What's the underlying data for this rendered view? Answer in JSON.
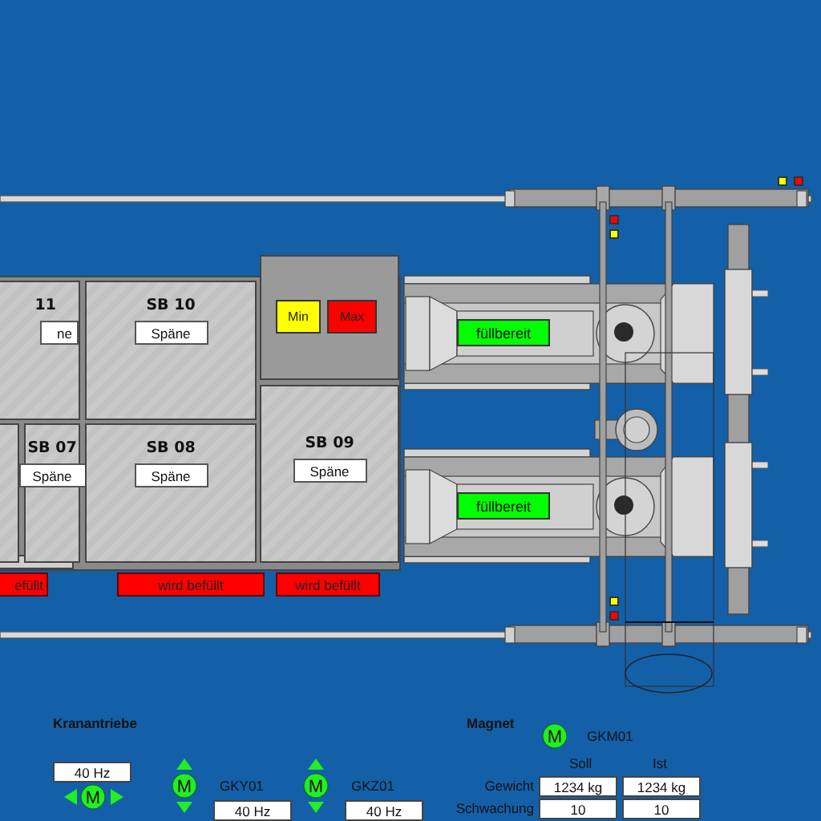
{
  "bunkers": [
    {
      "name": "11",
      "material": "ne"
    },
    {
      "name": "SB 10",
      "material": "Späne"
    },
    {
      "name": "SB 07",
      "material": "Späne"
    },
    {
      "name": "SB 08",
      "material": "Späne"
    },
    {
      "name": "SB 09",
      "material": "Späne"
    }
  ],
  "level_alarms": [
    {
      "label": "Min",
      "color": "#ffff00"
    },
    {
      "label": "Max",
      "color": "#ff0000"
    }
  ],
  "fill_status": [
    "efüllt",
    "wird befüllt",
    "wird befüllt"
  ],
  "presses": [
    {
      "status": "füllbereit"
    },
    {
      "status": "füllbereit"
    }
  ],
  "indicators": [
    {
      "color": "#ffff00"
    },
    {
      "color": "#ff0000"
    },
    {
      "color": "#ff0000"
    },
    {
      "color": "#ffff00"
    },
    {
      "color": "#ffff00"
    },
    {
      "color": "#ff0000"
    }
  ],
  "crane_drives": {
    "title": "Kranantriebe",
    "drives": [
      {
        "kind": "horizontal",
        "symbol": "M",
        "frequency": "40 Hz"
      },
      {
        "kind": "vertical",
        "symbol": "M",
        "name": "GKY01",
        "frequency": "40 Hz"
      },
      {
        "kind": "vertical",
        "symbol": "M",
        "name": "GKZ01",
        "frequency": "40 Hz"
      }
    ]
  },
  "magnet": {
    "title": "Magnet",
    "symbol": "M",
    "name": "GKM01",
    "columns": [
      "Soll",
      "Ist"
    ],
    "rows": [
      {
        "label": "Gewicht",
        "values": [
          "1234 kg",
          "1234 kg"
        ]
      },
      {
        "label": "Schwachung",
        "values": [
          "10",
          "10"
        ]
      }
    ]
  }
}
